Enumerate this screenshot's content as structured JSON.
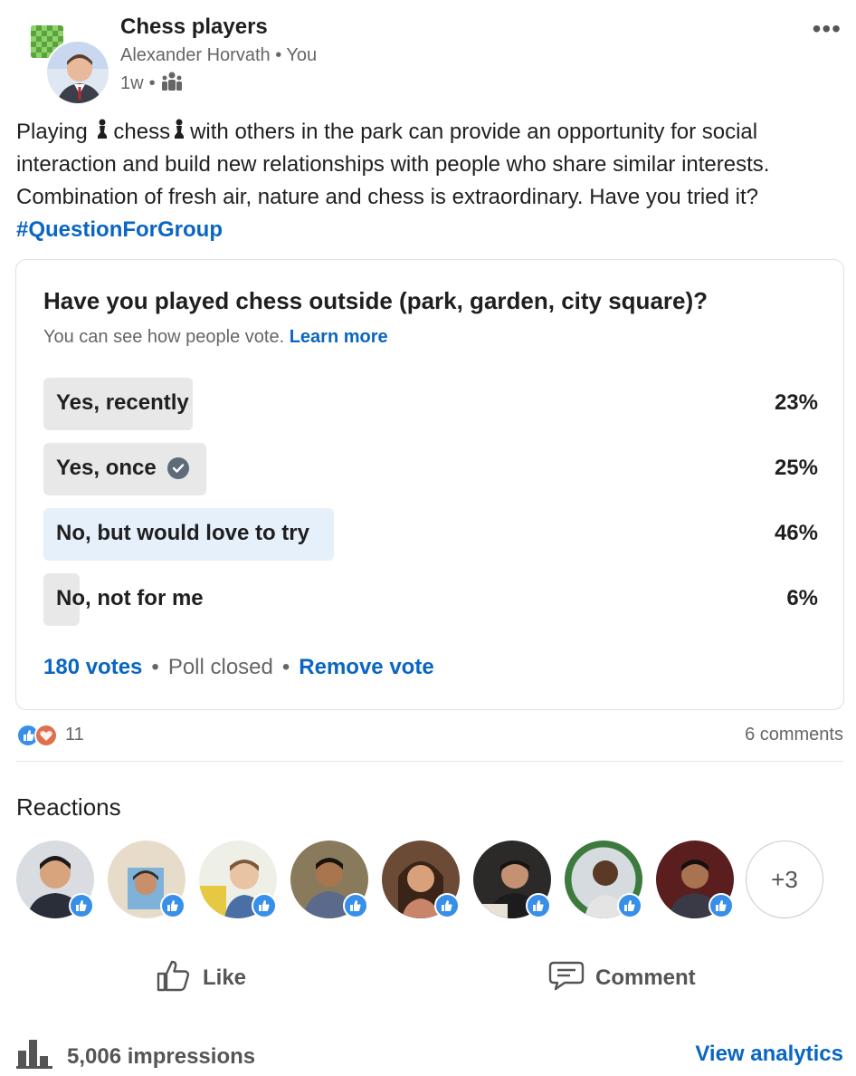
{
  "header": {
    "group_name": "Chess players",
    "author": "Alexander Horvath",
    "author_relation": "You",
    "time_ago": "1w",
    "more_label": "•••"
  },
  "post": {
    "text_part1": "Playing ",
    "text_part2": "chess",
    "text_part3": "with others in the park can provide an opportunity for social interaction and build new relationships with people who share similar interests. Combination of fresh air, nature and chess is extraordinary. Have you tried it?",
    "hashtag": "#QuestionForGroup"
  },
  "poll": {
    "question": "Have you played chess outside (park, garden, city square)?",
    "subtitle": "You can see how people vote.",
    "learn_more": "Learn more",
    "options": [
      {
        "label": "Yes, recently",
        "percent_label": "23%",
        "percent": 23,
        "selected": false,
        "voted": false
      },
      {
        "label": "Yes, once",
        "percent_label": "25%",
        "percent": 25,
        "selected": false,
        "voted": true
      },
      {
        "label": "No, but would love to try",
        "percent_label": "46%",
        "percent": 46,
        "selected": true,
        "voted": false
      },
      {
        "label": "No, not for me",
        "percent_label": "6%",
        "percent": 6,
        "selected": false,
        "voted": false
      }
    ],
    "votes": "180 votes",
    "status": "Poll closed",
    "remove_vote": "Remove vote"
  },
  "social": {
    "reaction_count": "11",
    "comments": "6 comments"
  },
  "reactions": {
    "title": "Reactions",
    "more": "+3"
  },
  "actions": {
    "like": "Like",
    "comment": "Comment"
  },
  "footer": {
    "impressions": "5,006 impressions",
    "view_analytics": "View analytics"
  },
  "colors": {
    "link": "#0a66c2",
    "like_badge": "#378fe9",
    "selected_bar": "#e5f0fb",
    "bar": "#e8e8e8"
  }
}
